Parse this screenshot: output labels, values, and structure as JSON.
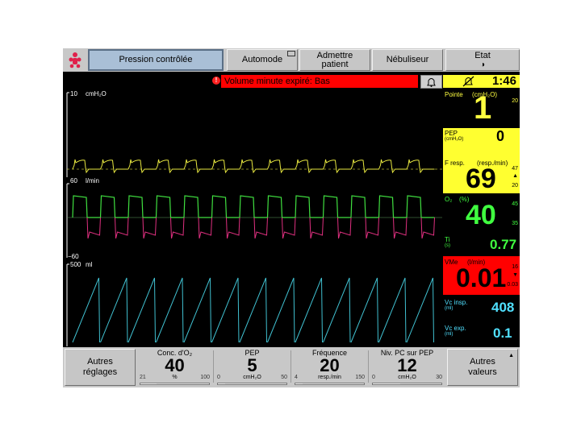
{
  "toolbar": {
    "mode": "Pression contrôlée",
    "automode": "Automode",
    "admit_line1": "Admettre",
    "admit_line2": "patient",
    "nebulizer": "Nébuliseur",
    "state_label": "Etat"
  },
  "alarm": {
    "message": "Volume minute expiré: Bas",
    "icon_glyph": "!",
    "timer": "1:46"
  },
  "waves": {
    "pressure": {
      "scale_top": "10",
      "unit": "cmH₂O"
    },
    "flow": {
      "scale_top": "60",
      "unit": "l/min",
      "scale_bottom": "−60"
    },
    "volume": {
      "scale_top": "500",
      "unit": "ml"
    }
  },
  "params": {
    "peak": {
      "label": "Pointe",
      "unit": "(cmH₂O)",
      "value": "1",
      "limit_high": "20",
      "color": "#ffff40"
    },
    "pep": {
      "label": "PEP",
      "unit": "(cmH₂O)",
      "value": "0",
      "bg": "#ffff30"
    },
    "fresp": {
      "label": "F resp.",
      "unit": "(resp./min)",
      "value": "69",
      "limit_high": "47",
      "limit_low": "20",
      "bg": "#ffff30"
    },
    "o2": {
      "label": "O₂",
      "unit": "(%)",
      "value": "40",
      "limit_high": "45",
      "limit_low": "35",
      "color": "#40ff40"
    },
    "ti": {
      "label": "Ti",
      "unit": "(s)",
      "value": "0.77",
      "color": "#40ff40"
    },
    "vme": {
      "label": "VMe",
      "unit": "(l/min)",
      "value": "0.01",
      "limit_high": "16",
      "limit_low": "0.03",
      "bg": "#ff0000"
    },
    "vc_insp": {
      "label": "Vc insp.",
      "unit": "(ml)",
      "value": "408",
      "color": "#50e0ff"
    },
    "vc_exp": {
      "label": "Vc exp.",
      "unit": "(ml)",
      "value": "0.1",
      "color": "#50e0ff"
    }
  },
  "bottom": {
    "other_settings_1": "Autres",
    "other_settings_2": "réglages",
    "other_values_1": "Autres",
    "other_values_2": "valeurs",
    "settings": [
      {
        "label": "Conc. d'O₂",
        "value": "40",
        "unit": "%",
        "min": "21",
        "max": "100",
        "level": 0.24
      },
      {
        "label": "PEP",
        "value": "5",
        "unit": "cmH₂O",
        "min": "0",
        "max": "50",
        "level": 0.1
      },
      {
        "label": "Fréquence",
        "value": "20",
        "unit": "resp./min",
        "min": "4",
        "max": "150",
        "level": 0.11
      },
      {
        "label": "Niv. PC sur PEP",
        "value": "12",
        "unit": "cmH₂O",
        "min": "0",
        "max": "30",
        "level": 0.4
      }
    ]
  },
  "colors": {
    "pressure_wave": "#e8e840",
    "flow_wave": "#40e040",
    "flow_wave_exp": "#e03080",
    "volume_wave": "#40c0d0"
  }
}
